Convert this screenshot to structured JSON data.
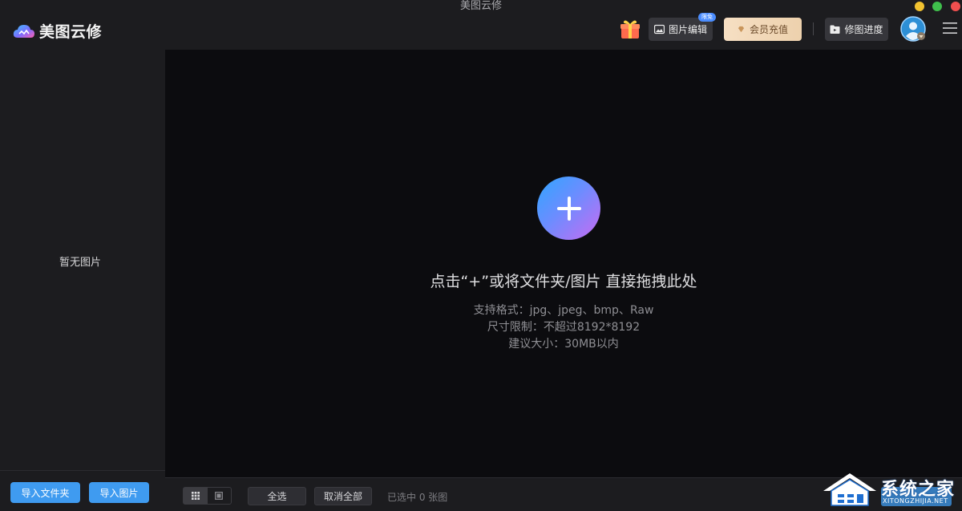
{
  "window": {
    "title": "美图云修"
  },
  "app": {
    "name": "美图云修"
  },
  "header": {
    "edit_button": {
      "label": "图片编辑",
      "badge": "限免"
    },
    "vip_button": {
      "label": "会员充值"
    },
    "progress_button": {
      "label": "修图进度"
    }
  },
  "sidebar": {
    "empty_text": "暂无图片",
    "import_folder": "导入文件夹",
    "import_image": "导入图片"
  },
  "main": {
    "drop_title": "点击“+”或将文件夹/图片 直接拖拽此处",
    "hints": [
      "支持格式：jpg、jpeg、bmp、Raw",
      "尺寸限制：不超过8192*8192",
      "建议大小：30MB以内"
    ]
  },
  "bottombar": {
    "select_all": "全选",
    "deselect_all": "取消全部",
    "selected_count": "已选中 0 张图"
  },
  "watermark": {
    "text": "系统之家",
    "url": "XITONGZHIJIA.NET"
  },
  "colors": {
    "accent": "#3f9bf0",
    "panel": "#1c1c1f",
    "canvas": "#0c0c0f",
    "vip_gold": "#f6dfc3"
  },
  "icons": {
    "logo": "meitu-cloud-logo",
    "gift": "gift-icon",
    "edit": "image-icon",
    "vip": "diamond-icon",
    "progress": "folder-icon",
    "avatar": "user-avatar",
    "menu": "hamburger-menu-icon",
    "add": "plus-icon"
  }
}
